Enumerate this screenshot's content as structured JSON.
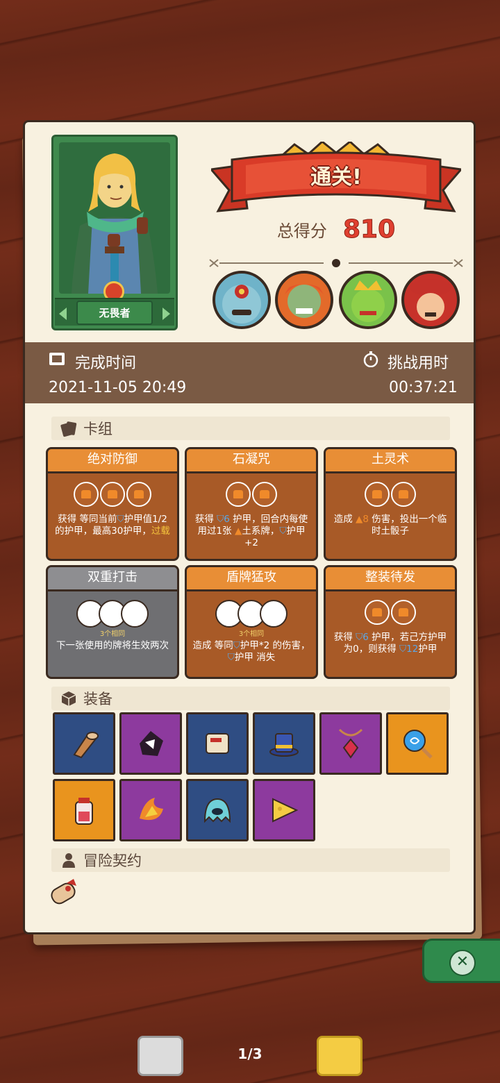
{
  "hero": {
    "name": "无畏者"
  },
  "result": {
    "banner": "通关!",
    "score_label": "总得分",
    "score_value": "810"
  },
  "time": {
    "complete_label": "完成时间",
    "complete_value": "2021-11-05 20:49",
    "challenge_label": "挑战用时",
    "challenge_value": "00:37:21"
  },
  "deck": {
    "title": "卡组",
    "cards": [
      {
        "name": "绝对防御",
        "desc_before": "获得 等同当前",
        "desc_mid": "护甲值1/2的护甲，最高30护甲，",
        "desc_hl": "过载"
      },
      {
        "name": "石凝咒",
        "desc_before": "获得 ",
        "num": "6",
        "desc_mid": " 护甲，回合内每使用过1张 ",
        "desc_after": "土系牌，",
        "desc_end": "护甲+2"
      },
      {
        "name": "土灵术",
        "desc_before": "造成 ",
        "num": "8",
        "desc_mid": " 伤害，投出一个临时土骰子"
      },
      {
        "name": "双重打击",
        "same": "3个相同",
        "desc_before": "下一张使用的牌将生效两次"
      },
      {
        "name": "盾牌猛攻",
        "same": "3个相同",
        "desc_before": "造成 等同",
        "desc_mid": "护甲*2 的伤害，",
        "desc_after": "护甲 消失"
      },
      {
        "name": "整装待发",
        "desc_before": "获得 ",
        "num": "6",
        "desc_mid": " 护甲，若己方护甲为0，则获得 ",
        "num2": "12",
        "desc_after": "护甲"
      }
    ]
  },
  "equipment": {
    "title": "装备",
    "items": [
      {
        "icon": "trumpet-icon",
        "color": "blue"
      },
      {
        "icon": "dark-shard-icon",
        "color": "purple"
      },
      {
        "icon": "scroll-icon",
        "color": "blue"
      },
      {
        "icon": "top-hat-icon",
        "color": "blue"
      },
      {
        "icon": "red-gem-amulet-icon",
        "color": "purple"
      },
      {
        "icon": "blue-orb-wand-icon",
        "color": "orange"
      },
      {
        "icon": "potion-jar-icon",
        "color": "orange"
      },
      {
        "icon": "fire-crystal-icon",
        "color": "purple"
      },
      {
        "icon": "ghost-slime-icon",
        "color": "blue"
      },
      {
        "icon": "cheese-wedge-icon",
        "color": "purple"
      }
    ]
  },
  "contract": {
    "title": "冒险契约"
  },
  "pagination": {
    "indicator": "1/3"
  },
  "colors": {
    "orange": "#e88e36",
    "blue_num": "#5aa8e8",
    "highlight": "#f4c43d",
    "score": "#e04030"
  }
}
